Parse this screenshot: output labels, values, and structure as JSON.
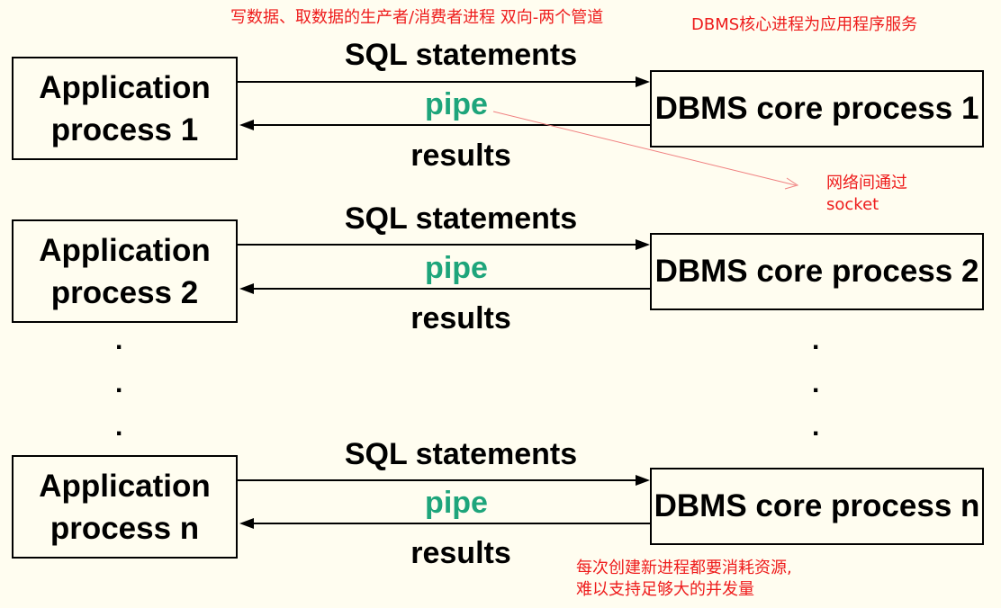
{
  "notes": {
    "top_left": "写数据、取数据的生产者/消费者进程 双向-两个管道",
    "top_right": "DBMS核心进程为应用程序服务",
    "socket_line1": "网络间通过",
    "socket_line2": "socket",
    "bottom_line1": "每次创建新进程都要消耗资源,",
    "bottom_line2": "难以支持足够大的并发量"
  },
  "rows": [
    {
      "app_line1": "Application",
      "app_line2": "process 1",
      "dbms": "DBMS core process 1",
      "request": "SQL statements",
      "channel": "pipe",
      "response": "results"
    },
    {
      "app_line1": "Application",
      "app_line2": "process 2",
      "dbms": "DBMS core process 2",
      "request": "SQL statements",
      "channel": "pipe",
      "response": "results"
    },
    {
      "app_line1": "Application",
      "app_line2": "process n",
      "dbms": "DBMS core process n",
      "request": "SQL statements",
      "channel": "pipe",
      "response": "results"
    }
  ],
  "ellipsis": "."
}
